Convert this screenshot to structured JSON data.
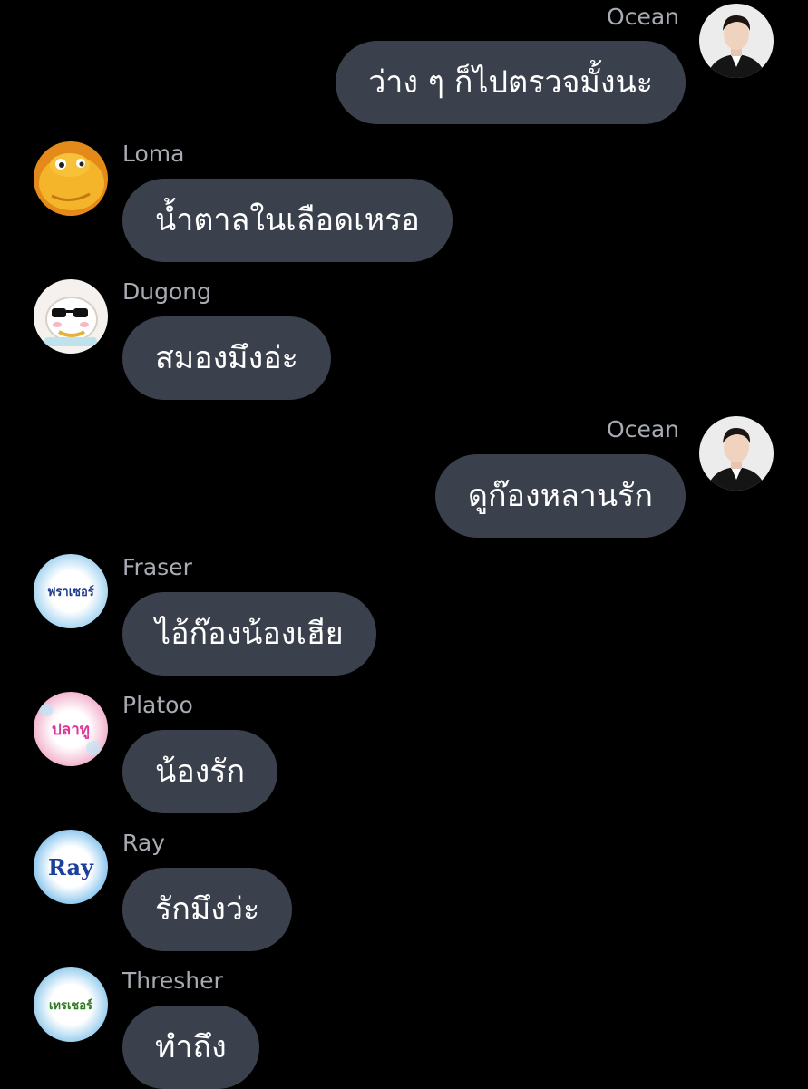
{
  "messages": [
    {
      "sender": "Ocean",
      "text": "ว่าง ๆ ก็ไปตรวจมั้งนะ",
      "own": true,
      "avatar": "person-photo-icon"
    },
    {
      "sender": "Loma",
      "text": "น้ำตาลในเลือดเหรอ",
      "own": false,
      "avatar": "yellow-creature-icon"
    },
    {
      "sender": "Dugong",
      "text": "สมองมึงอ่ะ",
      "own": false,
      "avatar": "cat-sunglasses-icon"
    },
    {
      "sender": "Ocean",
      "text": "ดูก๊องหลานรัก",
      "own": true,
      "avatar": "person-photo-icon"
    },
    {
      "sender": "Fraser",
      "text": "ไอ้ก๊องน้องเฮีย",
      "own": false,
      "avatar_label": "ฟราเซอร์",
      "avatar_color": "#1f3c8f"
    },
    {
      "sender": "Platoo",
      "text": "น้องรัก",
      "own": false,
      "avatar_label": "ปลาทู",
      "avatar_color": "#e0369a"
    },
    {
      "sender": "Ray",
      "text": "รักมึงว่ะ",
      "own": false,
      "avatar_label": "Ray",
      "avatar_color": "#1d3f9c"
    },
    {
      "sender": "Thresher",
      "text": "ทำถึง",
      "own": false,
      "avatar_label": "เทรเชอร์",
      "avatar_color": "#2c7a1f"
    }
  ],
  "colors": {
    "background": "#000000",
    "bubble": "#3b414c",
    "sender_name": "#a7abb2",
    "text": "#ffffff"
  }
}
